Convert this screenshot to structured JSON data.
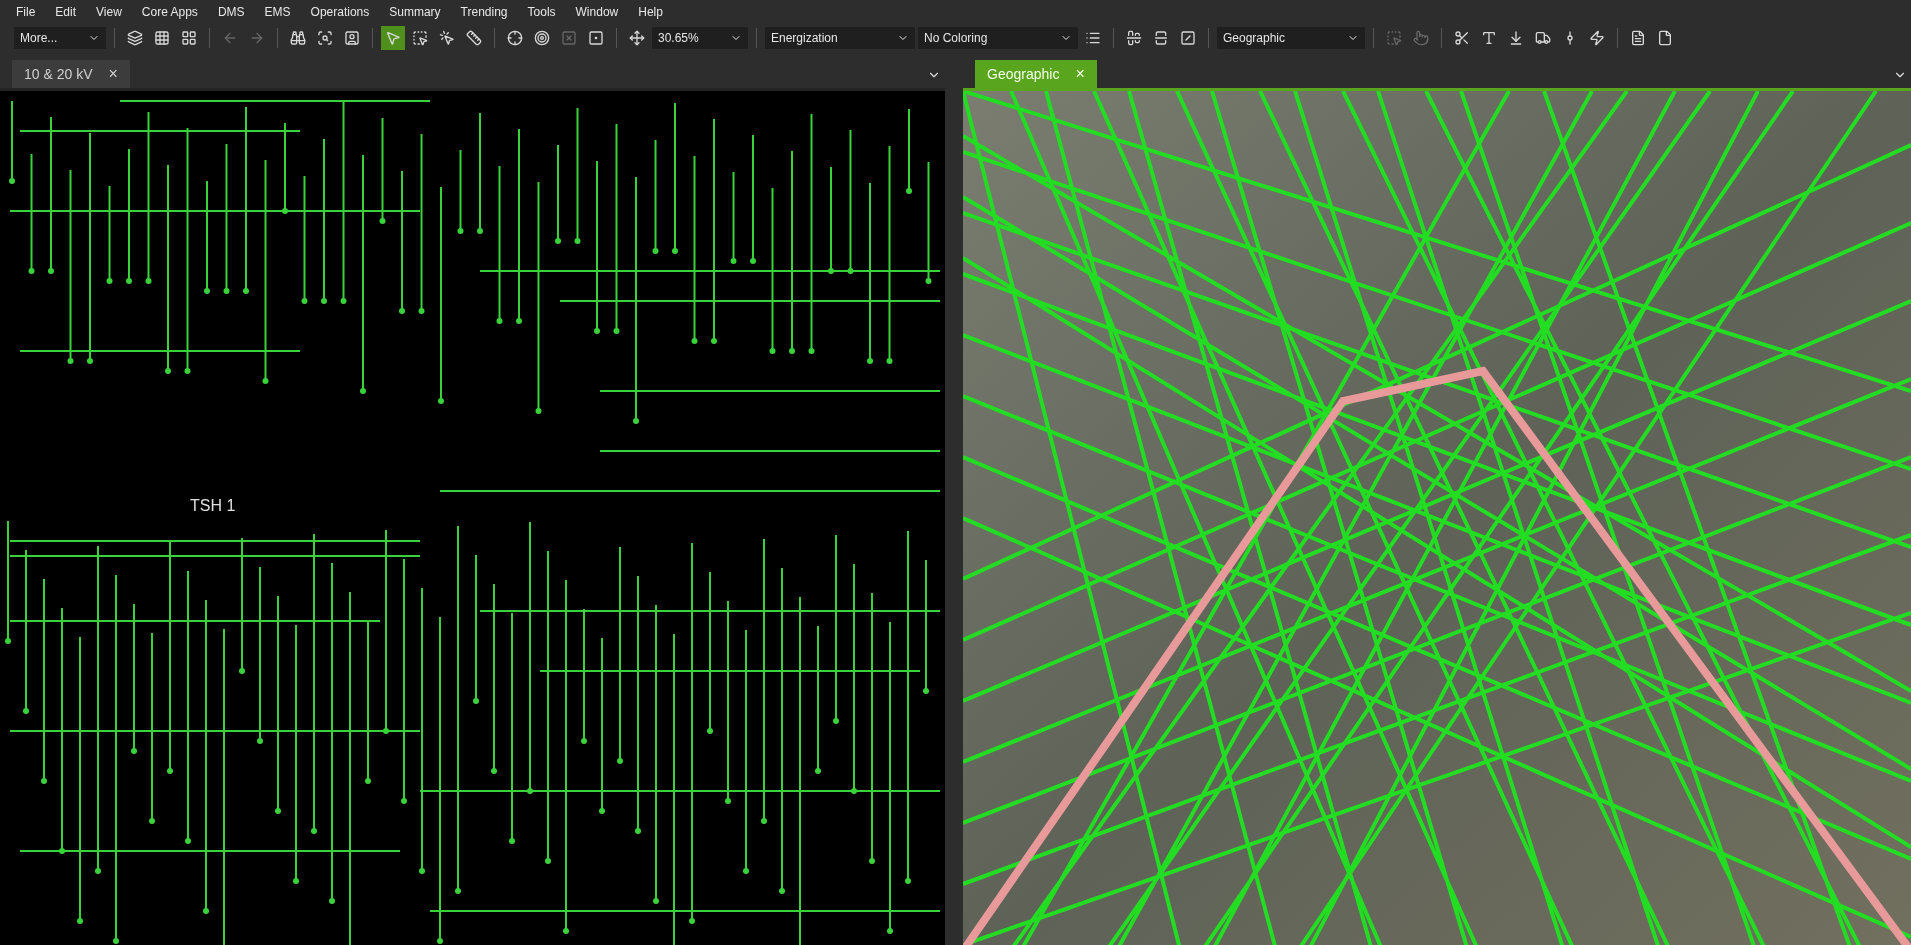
{
  "menu": [
    {
      "label": "File"
    },
    {
      "label": "Edit"
    },
    {
      "label": "View"
    },
    {
      "label": "Core Apps"
    },
    {
      "label": "DMS"
    },
    {
      "label": "EMS"
    },
    {
      "label": "Operations"
    },
    {
      "label": "Summary"
    },
    {
      "label": "Trending"
    },
    {
      "label": "Tools"
    },
    {
      "label": "Window"
    },
    {
      "label": "Help"
    }
  ],
  "toolbar": [
    {
      "kind": "dropdown",
      "value": "More..."
    },
    {
      "kind": "separator"
    },
    {
      "kind": "button",
      "selected": false
    },
    {
      "kind": "button",
      "selected": false
    },
    {
      "kind": "button",
      "selected": false
    },
    {
      "kind": "separator"
    },
    {
      "kind": "button",
      "selected": false,
      "disabled": true
    },
    {
      "kind": "button",
      "selected": false,
      "disabled": true
    },
    {
      "kind": "separator"
    },
    {
      "kind": "button",
      "selected": false
    },
    {
      "kind": "button",
      "selected": false
    },
    {
      "kind": "button",
      "selected": false
    },
    {
      "kind": "separator"
    },
    {
      "kind": "button",
      "selected": true
    },
    {
      "kind": "button",
      "selected": false
    },
    {
      "kind": "button",
      "selected": false
    },
    {
      "kind": "button",
      "selected": false
    },
    {
      "kind": "separator"
    },
    {
      "kind": "button",
      "selected": false
    },
    {
      "kind": "button",
      "selected": false
    },
    {
      "kind": "button",
      "selected": false,
      "disabled": true
    },
    {
      "kind": "button",
      "selected": false
    },
    {
      "kind": "separator"
    },
    {
      "kind": "button",
      "selected": false
    },
    {
      "kind": "dropdown",
      "value": "30.65%"
    },
    {
      "kind": "separator"
    },
    {
      "kind": "dropdown",
      "value": "Energization"
    },
    {
      "kind": "dropdown",
      "value": "No Coloring"
    },
    {
      "kind": "button",
      "selected": false
    },
    {
      "kind": "separator"
    },
    {
      "kind": "button",
      "selected": false
    },
    {
      "kind": "button",
      "selected": false
    },
    {
      "kind": "button",
      "selected": false
    },
    {
      "kind": "separator"
    },
    {
      "kind": "dropdown",
      "value": "Geographic"
    },
    {
      "kind": "separator"
    },
    {
      "kind": "button",
      "selected": false,
      "disabled": true
    },
    {
      "kind": "button",
      "selected": false,
      "disabled": true
    },
    {
      "kind": "separator"
    },
    {
      "kind": "button",
      "selected": false
    },
    {
      "kind": "button",
      "selected": false
    },
    {
      "kind": "button",
      "selected": false
    },
    {
      "kind": "button",
      "selected": false
    },
    {
      "kind": "button",
      "selected": false
    },
    {
      "kind": "button",
      "selected": false
    },
    {
      "kind": "separator"
    },
    {
      "kind": "button",
      "selected": false
    },
    {
      "kind": "button",
      "selected": false
    }
  ],
  "panels": [
    {
      "kind": "schematic",
      "tab": {
        "label": "10 & 20 kV",
        "selected": false
      },
      "close": "×",
      "bus_label": "TSH 1"
    },
    {
      "kind": "map",
      "tab": {
        "label": "Geographic",
        "selected": true
      },
      "close": "×"
    }
  ]
}
